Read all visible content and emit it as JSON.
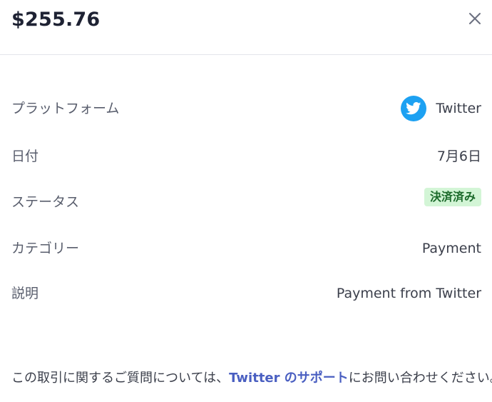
{
  "header": {
    "amount": "$255.76"
  },
  "details": {
    "platform_label": "プラットフォーム",
    "platform_value": "Twitter",
    "platform_icon": "twitter-bird-icon",
    "date_label": "日付",
    "date_value": "7月6日",
    "status_label": "ステータス",
    "status_value": "決済済み",
    "category_label": "カテゴリー",
    "category_value": "Payment",
    "description_label": "説明",
    "description_value": "Payment from Twitter"
  },
  "footer": {
    "prefix": "この取引に関するご質問については、",
    "link_text": "Twitter のサポート",
    "suffix": "にお問い合わせください。"
  },
  "colors": {
    "twitter_blue": "#1da1f2",
    "status_bg": "#d3f5d6",
    "status_text": "#1c6a2b",
    "link": "#4a5fc1"
  }
}
